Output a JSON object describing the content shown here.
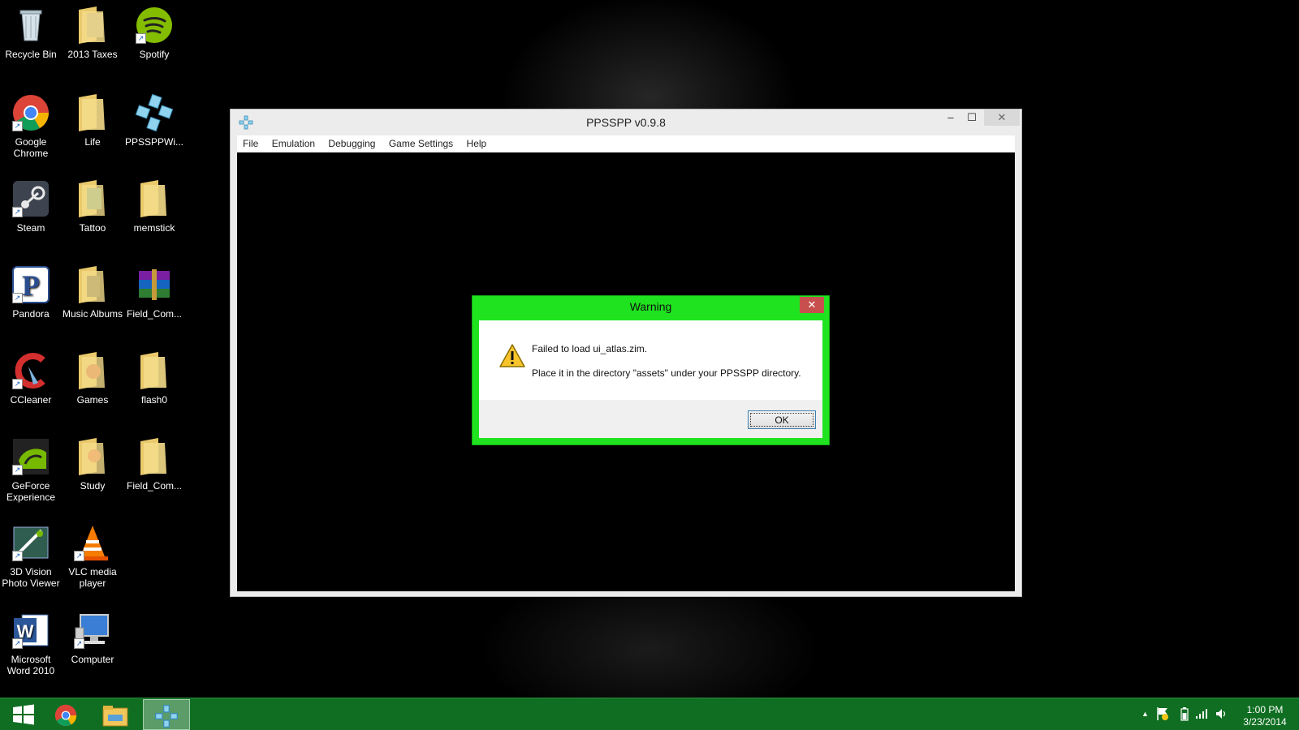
{
  "desktop": {
    "icons": [
      {
        "label": "Recycle Bin"
      },
      {
        "label": "2013 Taxes"
      },
      {
        "label": "Spotify"
      },
      {
        "label": "Google Chrome"
      },
      {
        "label": "Life"
      },
      {
        "label": "PPSSPPWi..."
      },
      {
        "label": "Steam"
      },
      {
        "label": "Tattoo"
      },
      {
        "label": "memstick"
      },
      {
        "label": "Pandora"
      },
      {
        "label": "Music Albums"
      },
      {
        "label": "Field_Com..."
      },
      {
        "label": "CCleaner"
      },
      {
        "label": "Games"
      },
      {
        "label": "flash0"
      },
      {
        "label": "GeForce Experience"
      },
      {
        "label": "Study"
      },
      {
        "label": "Field_Com..."
      },
      {
        "label": "3D Vision Photo Viewer"
      },
      {
        "label": "VLC media player"
      },
      {
        "label": "Microsoft Word 2010"
      },
      {
        "label": "Computer"
      }
    ]
  },
  "window": {
    "title": "PPSSPP v0.9.8",
    "minimize": "‒",
    "maximize": "☐",
    "close": "✕",
    "menu": [
      "File",
      "Emulation",
      "Debugging",
      "Game Settings",
      "Help"
    ]
  },
  "dialog": {
    "title": "Warning",
    "close": "✕",
    "message_line1": "Failed to load ui_atlas.zim.",
    "message_line2": "Place it in the directory \"assets\" under your PPSSPP directory.",
    "ok_label": "OK"
  },
  "taskbar": {
    "tray_arrow": "▲",
    "clock_time": "1:00 PM",
    "clock_date": "3/23/2014"
  },
  "colors": {
    "dialog_frame": "#1fe31f",
    "taskbar": "#0f6e21",
    "close_red": "#c7504f"
  }
}
